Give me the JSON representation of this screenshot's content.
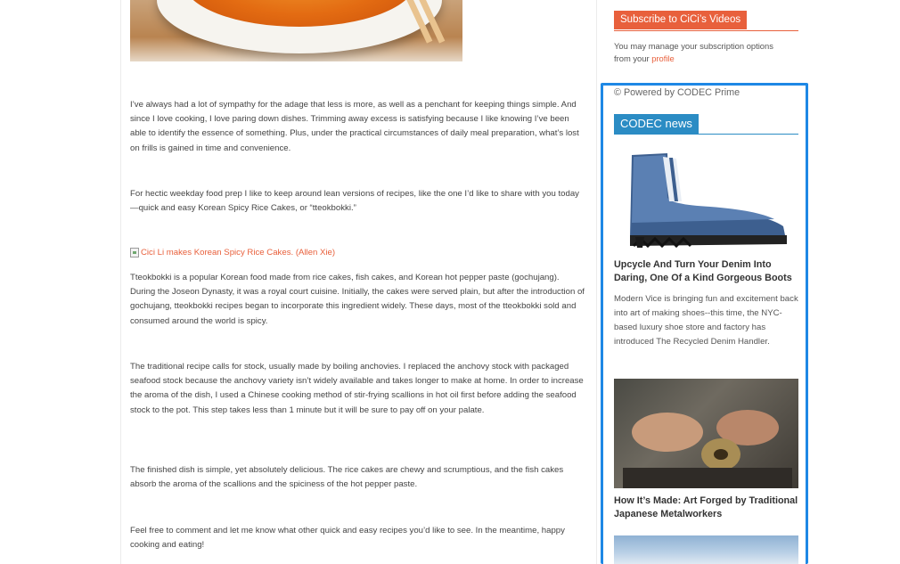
{
  "article": {
    "caption": "Cici Li makes Korean Spicy Rice Cakes. (Allen Xie)",
    "paragraphs": [
      "I’ve always had a lot of sympathy for the adage that less is more, as well as a penchant for keeping things simple. And since I love cooking, I love paring down dishes. Trimming away excess is satisfying because I like knowing I’ve been able to identify the essence of something. Plus, under the practical circumstances of daily meal preparation, what’s lost on frills is gained in time and convenience.",
      "For hectic weekday food prep I like to keep around lean versions of recipes, like the one I’d like to share with you today—quick and easy Korean Spicy Rice Cakes, or “tteokbokki.”",
      "Tteokbokki is a popular Korean food made from rice cakes, fish cakes, and Korean hot pepper paste (gochujang). During the Joseon Dynasty, it was a royal court cuisine. Initially, the cakes were served plain, but after the introduction of gochujang, tteokbokki recipes began to incorporate this ingredient widely. These days, most of the tteokbokki sold and consumed around the world is spicy.",
      "The traditional recipe calls for stock, usually made by boiling anchovies. I replaced the anchovy stock with packaged seafood stock because the anchovy variety isn’t widely available and takes longer to make at home. In order to increase the aroma of the dish, I used a Chinese cooking method of stir-frying scallions in hot oil first before adding the seafood stock to the pot. This step takes less than 1 minute but it will be sure to pay off on your palate.",
      "The finished dish is simple, yet absolutely delicious. The rice cakes are chewy and scrumptious, and the fish cakes absorb the aroma of the scallions and the spiciness of the hot pepper paste.",
      "Feel free to comment and let me know what other quick and easy recipes you’d like to see. In the meantime, happy cooking and eating!"
    ]
  },
  "sidebar": {
    "subscribe_title": "Subscribe to CiCi’s Videos",
    "subscribe_note": "You may manage your subscription options from your",
    "profile_link": "profile",
    "powered_by": "© Powered by CODEC Prime",
    "news_title": "CODEC news",
    "news": [
      {
        "title": "Upcycle And Turn Your Denim Into Daring, One Of a Kind Gorgeous Boots",
        "summary": "Modern Vice is bringing fun and excitement back into art of making shoes--this time, the NYC-based luxury shoe store and factory has introduced The Recycled Denim Handler."
      },
      {
        "title": "How It’s Made: Art Forged by Traditional Japanese Metalworkers"
      }
    ]
  },
  "colors": {
    "accent_orange": "#e8603c",
    "news_blue": "#2b8cc4",
    "highlight_blue": "#1e88e5"
  }
}
